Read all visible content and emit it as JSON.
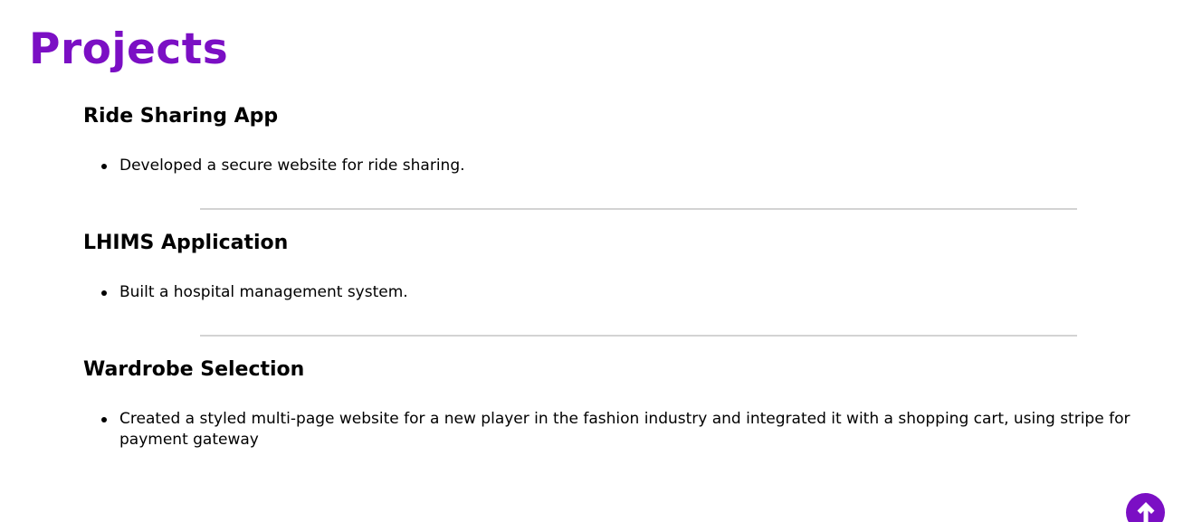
{
  "section": {
    "title": "Projects"
  },
  "projects": [
    {
      "title": "Ride Sharing App",
      "points": [
        "Developed a secure website for ride sharing."
      ]
    },
    {
      "title": "LHIMS Application",
      "points": [
        "Built a hospital management system."
      ]
    },
    {
      "title": "Wardrobe Selection",
      "points": [
        "Created a styled multi-page website for a new player in the fashion industry and integrated it with a shopping cart, using stripe for payment gateway"
      ]
    }
  ],
  "scroll_top_button": {
    "icon": "arrow-up-icon"
  },
  "colors": {
    "accent": "#7b0fc4",
    "divider": "#d3d3d3"
  }
}
